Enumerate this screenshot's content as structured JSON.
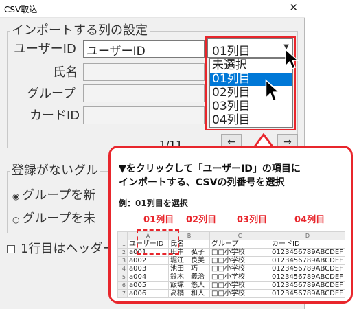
{
  "window": {
    "title": "CSV取込",
    "close_glyph": "✕"
  },
  "columns_group": {
    "legend": "インポートする列の設定",
    "fields": [
      {
        "label": "ユーザーID",
        "value": "ユーザーID"
      },
      {
        "label": "氏名",
        "value": ""
      },
      {
        "label": "グループ",
        "value": ""
      },
      {
        "label": "カードID",
        "value": ""
      }
    ],
    "select_value": "01列目",
    "dropdown_options": [
      "未選択",
      "01列目",
      "02列目",
      "03列目",
      "04列目"
    ],
    "selected_option": "01列目"
  },
  "pager": {
    "text": "1/11",
    "prev": "←",
    "next": "→"
  },
  "unregistered_group": {
    "legend": "登録がないグル",
    "radio1": "グループを新",
    "radio2": "グループを未"
  },
  "header_check": {
    "label": "1行目はヘッダー"
  },
  "callout": {
    "line1": "▼をクリックして「ユーザーID」の項目に",
    "line2": "インポートする、CSVの列番号を選択",
    "example": "例：01列目を選択",
    "col_labels": [
      "01列目",
      "02列目",
      "03列目",
      "04列目"
    ],
    "sheet": {
      "col_letters": [
        "A",
        "B",
        "C",
        "D"
      ],
      "rows": [
        [
          "1",
          "ユーザーID",
          "氏名",
          "グループ",
          "カードID"
        ],
        [
          "2",
          "a001",
          "田中　弘子",
          "□□小学校",
          "0123456789ABCDEF"
        ],
        [
          "3",
          "a002",
          "堀江　良美",
          "□□小学校",
          "0123456789ABCDEF"
        ],
        [
          "4",
          "a003",
          "池田　巧",
          "□□小学校",
          "0123456789ABCDEF"
        ],
        [
          "5",
          "a004",
          "鈴木　義治",
          "□□小学校",
          "0123456789ABCDEF"
        ],
        [
          "6",
          "a005",
          "飯塚　悠人",
          "□□小学校",
          "0123456789ABCDEF"
        ],
        [
          "7",
          "a006",
          "高橋　和人",
          "□□小学校",
          "0123456789ABCDEF"
        ]
      ]
    }
  },
  "colors": {
    "accent_red": "#e8262c",
    "selection_blue": "#0078d7"
  }
}
